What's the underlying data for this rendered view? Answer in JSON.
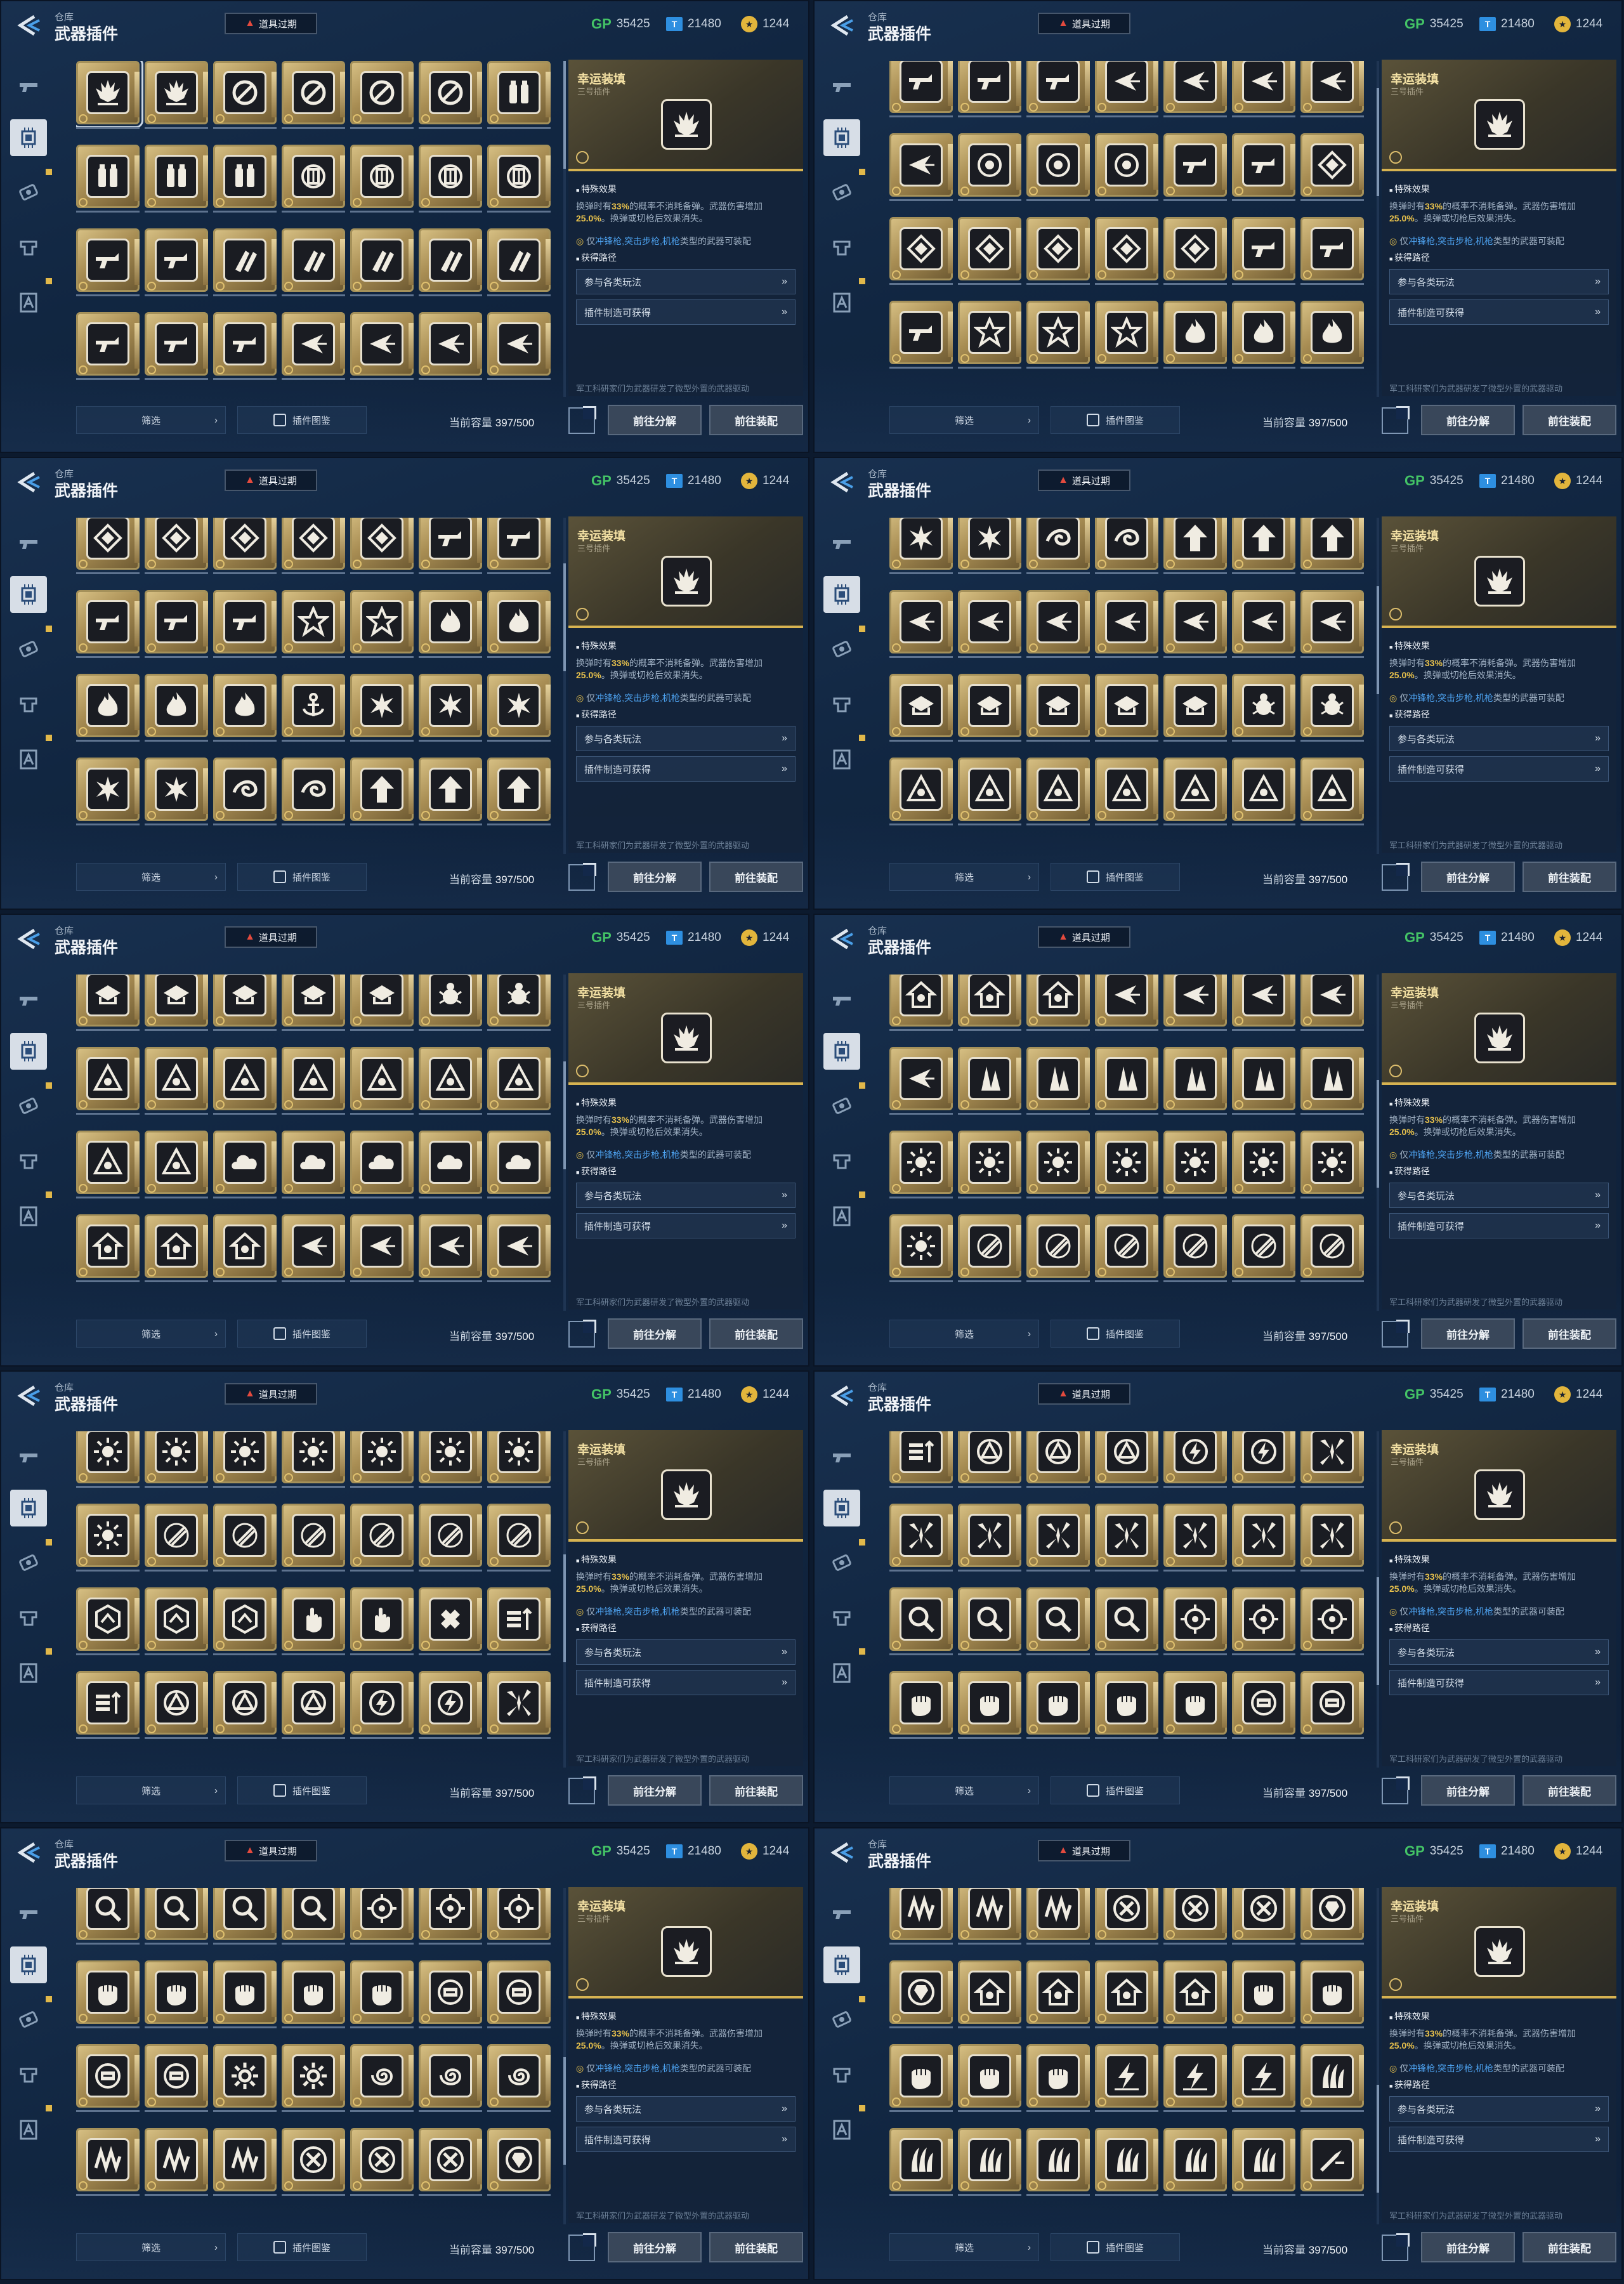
{
  "screen": {
    "crumb": "仓库",
    "title": "武器插件",
    "expired_label": "道具过期",
    "currency": [
      {
        "name": "gp",
        "icon": "GP",
        "value": "35425"
      },
      {
        "name": "ticket",
        "icon": "T",
        "value": "21480"
      },
      {
        "name": "coin",
        "icon": "coin-icon",
        "value": "1244"
      }
    ],
    "nav": [
      "pistol-icon",
      "chip-icon",
      "scope-icon",
      "armor-icon",
      "emblem-icon"
    ],
    "detail": {
      "name": "幸运装填",
      "subtitle": "三号插件",
      "effect_title": "特殊效果",
      "effect_pre": "换弹时有",
      "effect_pct": "33%",
      "effect_mid": "的概率不消耗备弹。武器伤害增加",
      "effect_dmg": "25.0%",
      "effect_post": "。换弹或切枪后效果消失。",
      "limit_pre": "仅",
      "limit_weapons": "冲锋枪,突击步枪,机枪",
      "limit_post": "类型的武器可装配",
      "source_title": "获得路径",
      "source_1": "参与各类玩法",
      "source_2": "插件制造可获得",
      "flavor": "军工科研家们为武器研发了微型外置的武器驱动"
    },
    "filter": "筛选",
    "atlas": "插件图鉴",
    "capacity_label": "当前容量",
    "capacity_value": "397/500",
    "btn_disassemble": "前往分解",
    "btn_equip": "前往装配"
  },
  "grids": [
    {
      "scroll": 0.0,
      "rows": [
        [
          "wing",
          "wing",
          "ban",
          "ban",
          "ban",
          "ban",
          "canister"
        ],
        [
          "canister",
          "canister",
          "canister",
          "ring",
          "ring",
          "ring",
          "ring"
        ],
        [
          "gun",
          "gun",
          "bullet",
          "bullet",
          "bullet",
          "bullet",
          "bullet"
        ],
        [
          "gun",
          "gun",
          "gun",
          "dart",
          "dart",
          "dart",
          "dart"
        ]
      ]
    },
    {
      "scroll": 0.12,
      "rows": [
        [
          "gun",
          "gun",
          "gun",
          "dart",
          "dart",
          "dart",
          "dart"
        ],
        [
          "dart",
          "target",
          "target",
          "target",
          "gun",
          "gun",
          "diamond"
        ],
        [
          "diamond",
          "diamond",
          "diamond",
          "diamond",
          "diamond",
          "gun",
          "gun"
        ],
        [
          "gun",
          "star",
          "star",
          "star",
          "flame",
          "flame",
          "flame"
        ]
      ]
    },
    {
      "scroll": 0.2,
      "rows": [
        [
          "diamond",
          "diamond",
          "diamond",
          "diamond",
          "diamond",
          "gun",
          "gun"
        ],
        [
          "gun",
          "gun",
          "gun",
          "star",
          "star",
          "flame",
          "flame"
        ],
        [
          "flame",
          "flame",
          "flame",
          "anchor",
          "burst",
          "burst",
          "burst"
        ],
        [
          "burst",
          "burst",
          "swirl",
          "swirl",
          "arrow",
          "arrow",
          "arrow"
        ]
      ]
    },
    {
      "scroll": 0.3,
      "rows": [
        [
          "burst",
          "burst",
          "swirl",
          "swirl",
          "arrow",
          "arrow",
          "arrow"
        ],
        [
          "dart",
          "dart",
          "dart",
          "dart",
          "dart",
          "dart",
          "dart"
        ],
        [
          "hat",
          "hat",
          "hat",
          "hat",
          "hat",
          "bug",
          "bug"
        ],
        [
          "triangle",
          "triangle",
          "triangle",
          "triangle",
          "triangle",
          "triangle",
          "triangle"
        ]
      ]
    },
    {
      "scroll": 0.38,
      "rows": [
        [
          "hat",
          "hat",
          "hat",
          "hat",
          "hat",
          "bug",
          "bug"
        ],
        [
          "triangle",
          "triangle",
          "triangle",
          "triangle",
          "triangle",
          "triangle",
          "triangle"
        ],
        [
          "triangle",
          "triangle",
          "cloud",
          "cloud",
          "cloud",
          "cloud",
          "cloud"
        ],
        [
          "house",
          "house",
          "house",
          "dart",
          "dart",
          "dart",
          "dart"
        ]
      ]
    },
    {
      "scroll": 0.46,
      "rows": [
        [
          "house",
          "house",
          "house",
          "dart",
          "dart",
          "dart",
          "dart"
        ],
        [
          "dart",
          "spike",
          "spike",
          "spike",
          "spike",
          "spike",
          "spike"
        ],
        [
          "sun",
          "sun",
          "sun",
          "sun",
          "sun",
          "sun",
          "sun"
        ],
        [
          "sun",
          "slash",
          "slash",
          "slash",
          "slash",
          "slash",
          "slash"
        ]
      ]
    },
    {
      "scroll": 0.54,
      "rows": [
        [
          "sun",
          "sun",
          "sun",
          "sun",
          "sun",
          "sun",
          "sun"
        ],
        [
          "sun",
          "slash",
          "slash",
          "slash",
          "slash",
          "slash",
          "slash"
        ],
        [
          "hex",
          "hex",
          "hex",
          "hand",
          "hand",
          "cross",
          "bars"
        ],
        [
          "bars",
          "tri",
          "tri",
          "tri",
          "bolt",
          "bolt",
          "shatter"
        ]
      ]
    },
    {
      "scroll": 0.64,
      "rows": [
        [
          "bars",
          "tri",
          "tri",
          "tri",
          "bolt",
          "bolt",
          "shatter"
        ],
        [
          "shatter",
          "shatter",
          "shatter",
          "shatter",
          "shatter",
          "shatter",
          "shatter"
        ],
        [
          "magnify",
          "magnify",
          "magnify",
          "magnify",
          "reticle",
          "reticle",
          "reticle"
        ],
        [
          "fist",
          "fist",
          "fist",
          "fist",
          "fist",
          "plug",
          "plug"
        ]
      ]
    },
    {
      "scroll": 0.74,
      "rows": [
        [
          "magnify",
          "magnify",
          "magnify",
          "magnify",
          "reticle",
          "reticle",
          "reticle"
        ],
        [
          "fist",
          "fist",
          "fist",
          "fist",
          "fist",
          "plug",
          "plug"
        ],
        [
          "plug",
          "plug",
          "cog",
          "cog",
          "spiral",
          "spiral",
          "spiral"
        ],
        [
          "wave",
          "wave",
          "wave",
          "x",
          "x",
          "x",
          "gem"
        ]
      ]
    },
    {
      "scroll": 0.86,
      "rows": [
        [
          "wave",
          "wave",
          "wave",
          "x",
          "x",
          "x",
          "gem"
        ],
        [
          "gem",
          "house",
          "house",
          "house",
          "house",
          "fist",
          "fist"
        ],
        [
          "fist",
          "fist",
          "fist",
          "zap",
          "zap",
          "zap",
          "claw"
        ],
        [
          "claw",
          "claw",
          "claw",
          "claw",
          "claw",
          "claw",
          "drill"
        ]
      ]
    }
  ]
}
